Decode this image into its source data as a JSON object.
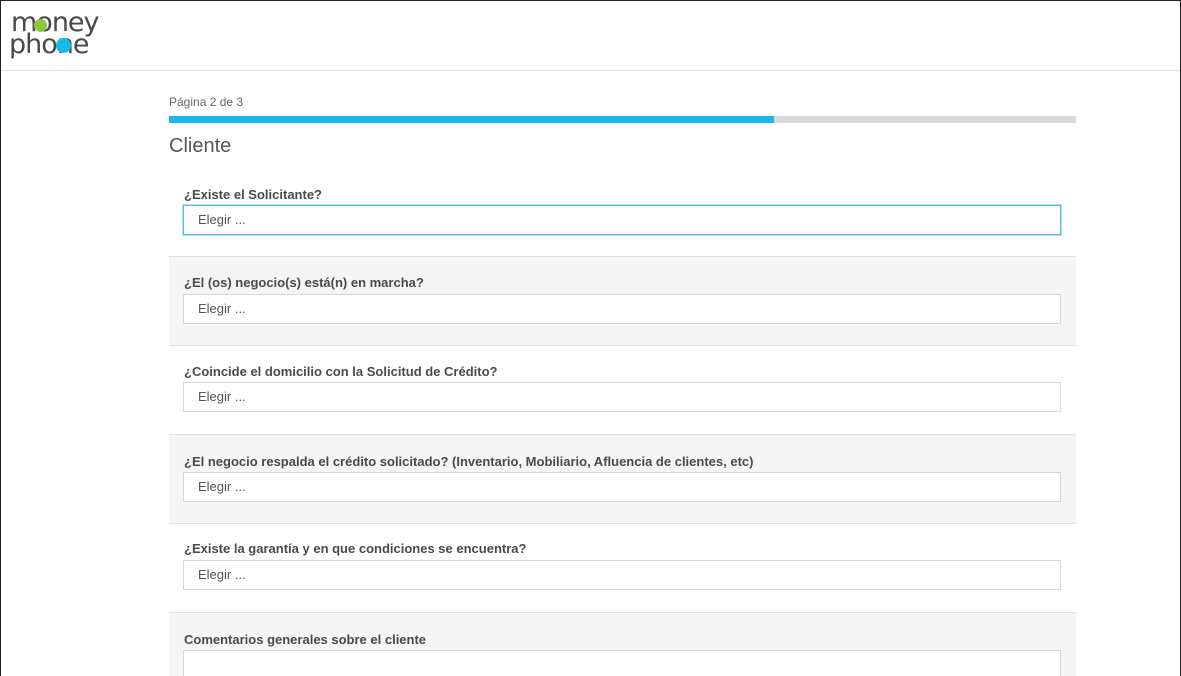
{
  "brand": {
    "logo_text_line1": "money",
    "logo_text_line2": "phone",
    "colors": {
      "green": "#8dc63f",
      "blue": "#1ab7ea"
    }
  },
  "progress": {
    "label": "Página 2 de 3",
    "fraction": 0.667,
    "color": "#1ab7ea"
  },
  "section": {
    "title": "Cliente"
  },
  "questions": [
    {
      "label": "¿Existe el Solicitante?",
      "value": "Elegir ...",
      "focused": true
    },
    {
      "label": "¿El (os) negocio(s) está(n) en marcha?",
      "value": "Elegir ..."
    },
    {
      "label": "¿Coincide el domicilio con la Solicitud de Crédito?",
      "value": "Elegir ..."
    },
    {
      "label": "¿El negocio respalda el crédito solicitado? (Inventario, Mobiliario, Afluencia de clientes, etc)",
      "value": "Elegir ..."
    },
    {
      "label": "¿Existe la garantía y en que condiciones se encuentra?",
      "value": "Elegir ..."
    }
  ],
  "comments": {
    "label": "Comentarios generales sobre el cliente",
    "value": ""
  }
}
